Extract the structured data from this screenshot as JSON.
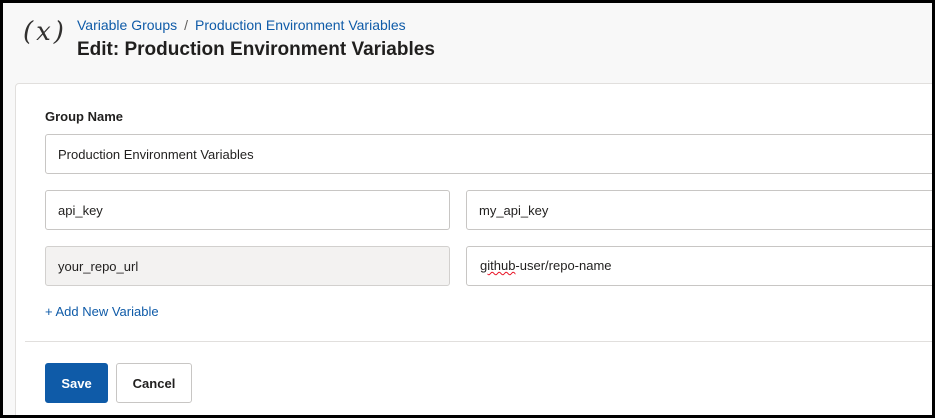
{
  "header": {
    "icon_text": "(x)",
    "breadcrumb": {
      "root": "Variable Groups",
      "separator": "/",
      "current": "Production Environment Variables"
    },
    "title": "Edit: Production Environment Variables"
  },
  "form": {
    "group_name_label": "Group Name",
    "group_name_value": "Production Environment Variables",
    "variables": [
      {
        "key": "api_key",
        "value": "my_api_key",
        "key_readonly": false
      },
      {
        "key": "your_repo_url",
        "value_misspelled": "github",
        "value_rest": "-user/repo-name",
        "key_readonly": true
      }
    ],
    "add_variable_label": "+ Add New Variable"
  },
  "actions": {
    "save_label": "Save",
    "cancel_label": "Cancel"
  },
  "colors": {
    "accent": "#0f5ba8",
    "background": "#f8f8f8",
    "border": "#c8c6c4"
  }
}
